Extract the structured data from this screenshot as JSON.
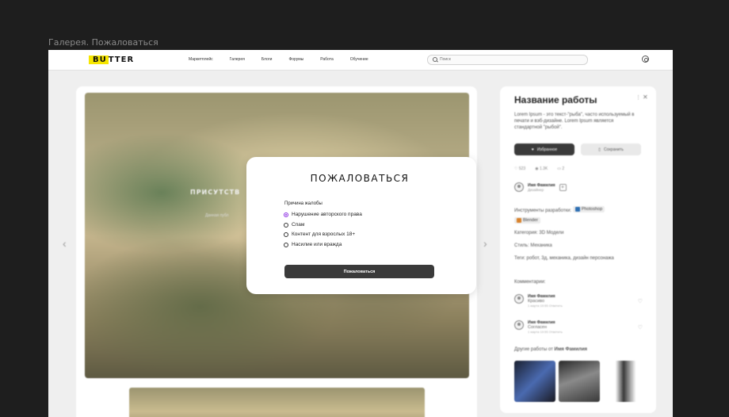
{
  "frame_title": "Галерея. Пожаловаться",
  "logo": {
    "highlight": "BU",
    "rest": "TTER"
  },
  "nav": [
    "Маркетплейс",
    "Галерея",
    "Блоги",
    "Форумы",
    "Работа",
    "Обучение"
  ],
  "search": {
    "placeholder": "Поиск"
  },
  "artwork": {
    "title": "ПРИСУТСТВ",
    "subtitle": "Данная публ"
  },
  "details": {
    "title": "Название работы",
    "description": "Lorem Ipsum - это текст-\"рыба\", часто используемый в печати и вэб-дизайне. Lorem Ipsum является стандартной \"рыбой\".",
    "favorite_label": "Избранное",
    "save_label": "Сохранить",
    "stats": {
      "likes": "523",
      "views": "1.3K",
      "comments": "2"
    },
    "author": {
      "name": "Имя Фамилия",
      "role": "Дизайнер"
    },
    "tools_label": "Инструменты разработки:",
    "tools": [
      {
        "name": "Photoshop",
        "color": "#2d6fb3"
      },
      {
        "name": "Blender",
        "color": "#d9822b"
      }
    ],
    "category": "Категория: 3D Модели",
    "style": "Стиль: Механика",
    "tags": "Теги: робот, 3д, механика, дизайн персонажа",
    "comments_label": "Комментарии:",
    "comments": [
      {
        "name": "Имя Фамилия",
        "text": "Красиво",
        "meta": "1 марта 19:55   Ответить"
      },
      {
        "name": "Имя Фамилия",
        "text": "Согласен",
        "meta": "1 марта 19:55   Ответить"
      }
    ],
    "other_works_prefix": "Другие работы от ",
    "other_works_author": "Имя Фамилия"
  },
  "modal": {
    "title": "ПОЖАЛОВАТЬСЯ",
    "reason_label": "Причина жалобы",
    "options": [
      {
        "label": "Нарушение авторского права",
        "selected": true
      },
      {
        "label": "Спам",
        "selected": false
      },
      {
        "label": "Контент для взрослых 18+",
        "selected": false
      },
      {
        "label": "Насилие или вражда",
        "selected": false
      }
    ],
    "submit_label": "Пожаловаться"
  }
}
